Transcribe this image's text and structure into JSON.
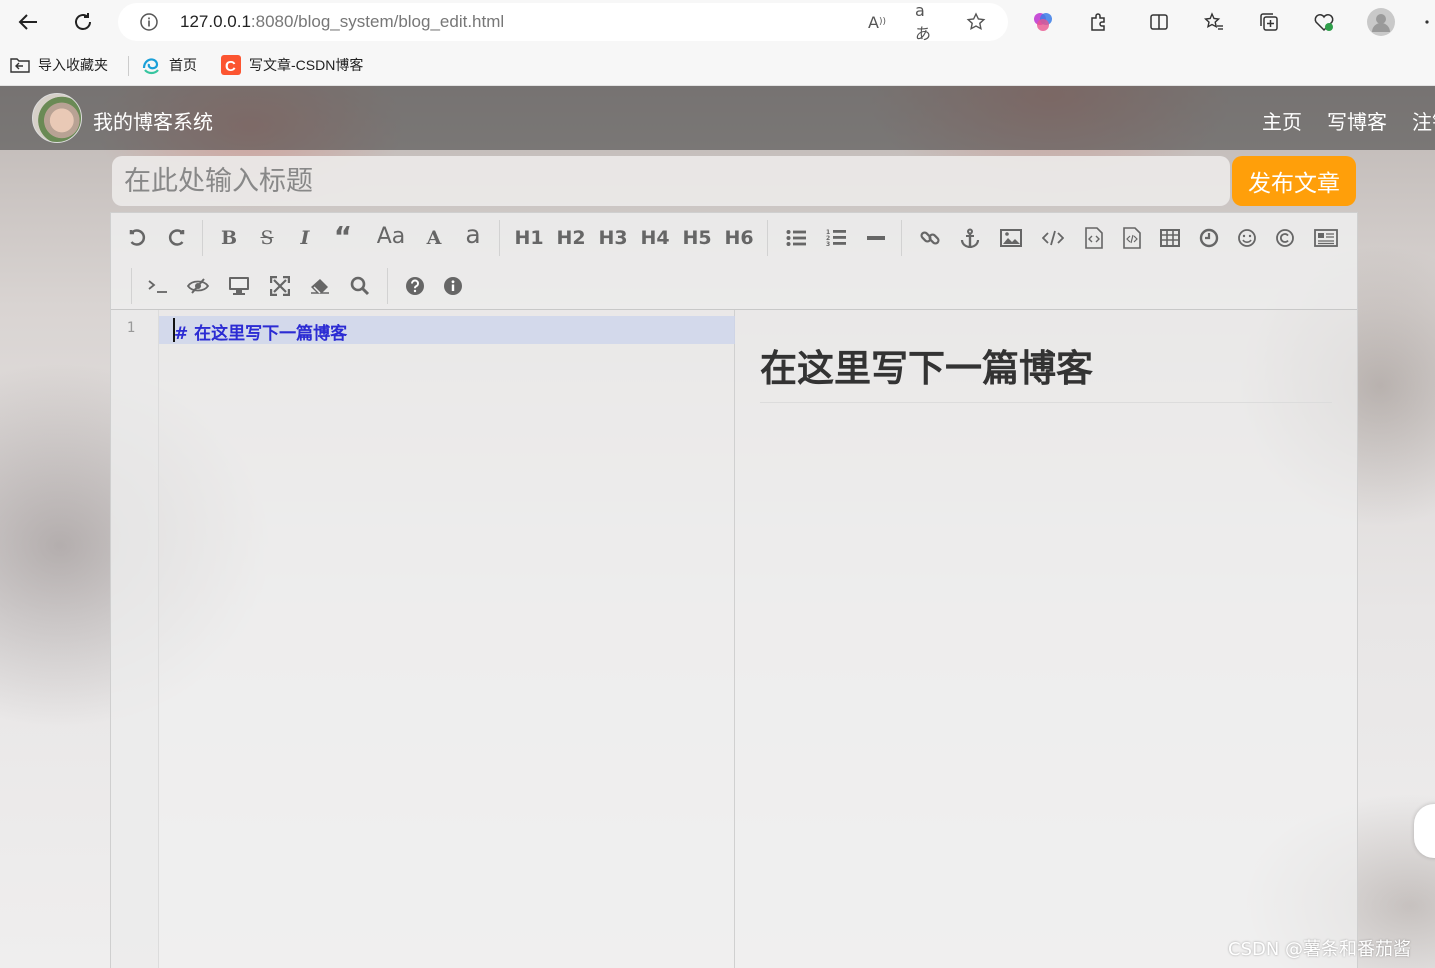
{
  "browser": {
    "url_host": "127.0.0.1",
    "url_path": ":8080/blog_system/blog_edit.html",
    "bookmarks": [
      {
        "label": "导入收藏夹",
        "icon": "import-folder-icon"
      },
      {
        "label": "首页",
        "icon": "edge-home-icon"
      },
      {
        "label": "写文章-CSDN博客",
        "icon": "csdn-icon"
      }
    ]
  },
  "navbar": {
    "site_title": "我的博客系统",
    "links": [
      "主页",
      "写博客",
      "注销"
    ]
  },
  "title_input": {
    "placeholder": "在此处输入标题",
    "value": ""
  },
  "publish_button": "发布文章",
  "toolbar": {
    "row1": [
      "undo",
      "redo",
      "bold",
      "strikethrough",
      "italic",
      "quote",
      "uppercase",
      "uppercase-first",
      "lowercase",
      "H1",
      "H2",
      "H3",
      "H4",
      "H5",
      "H6",
      "unordered-list",
      "ordered-list",
      "horizontal-rule",
      "link",
      "anchor",
      "image",
      "code",
      "preformatted-code",
      "code-block",
      "table",
      "datetime",
      "emoji",
      "html-entities",
      "pagebreak"
    ],
    "row2": [
      "goto-line",
      "watch",
      "preview",
      "fullscreen",
      "clear",
      "search",
      "help",
      "info"
    ],
    "text_labels": {
      "uppercase": "Aa",
      "uppercase_first": "A",
      "lowercase": "a",
      "h1": "H1",
      "h2": "H2",
      "h3": "H3",
      "h4": "H4",
      "h5": "H5",
      "h6": "H6"
    }
  },
  "editor": {
    "line_number": "1",
    "code_hash": "#",
    "code_text": "在这里写下一篇博客",
    "preview_heading": "在这里写下一篇博客"
  },
  "watermark": "CSDN @薯条和番茄酱",
  "colors": {
    "accent_orange": "#ff9f0a",
    "code_blue": "#2b2bd3"
  }
}
